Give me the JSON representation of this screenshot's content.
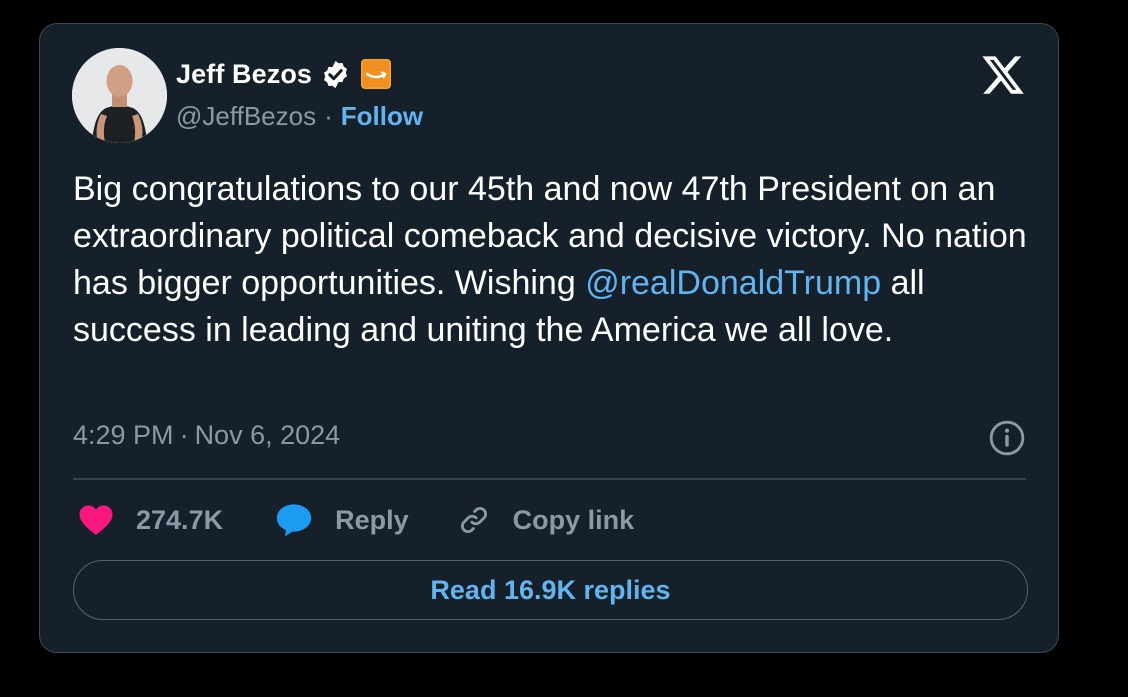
{
  "author": {
    "display_name": "Jeff Bezos",
    "handle": "@JeffBezos",
    "separator": "·",
    "follow_label": "Follow",
    "avatar_icon": "profile-photo",
    "verified_icon": "verified-badge-icon",
    "affiliation_icon": "amazon-logo-icon"
  },
  "platform_icon": "x-logo-icon",
  "tweet": {
    "text_before": "Big congratulations to our 45th and now 47th President on an extraordinary political comeback and decisive victory. No nation has bigger opportunities. Wishing ",
    "mention": "@realDonaldTrump",
    "text_after": " all success in leading and uniting the America we all love.",
    "time": "4:29 PM",
    "separator": "·",
    "date": "Nov 6, 2024"
  },
  "actions": {
    "likes_count": "274.7K",
    "reply_label": "Reply",
    "copy_link_label": "Copy link"
  },
  "read_replies_label": "Read 16.9K replies",
  "colors": {
    "card_background": "#15202b",
    "page_background": "#000000",
    "accent_blue": "#62b4f0",
    "like_pink": "#f91880",
    "reply_blue": "#1d9bf0",
    "muted_text": "#8b98a5",
    "brand_orange": "#f5a623"
  }
}
